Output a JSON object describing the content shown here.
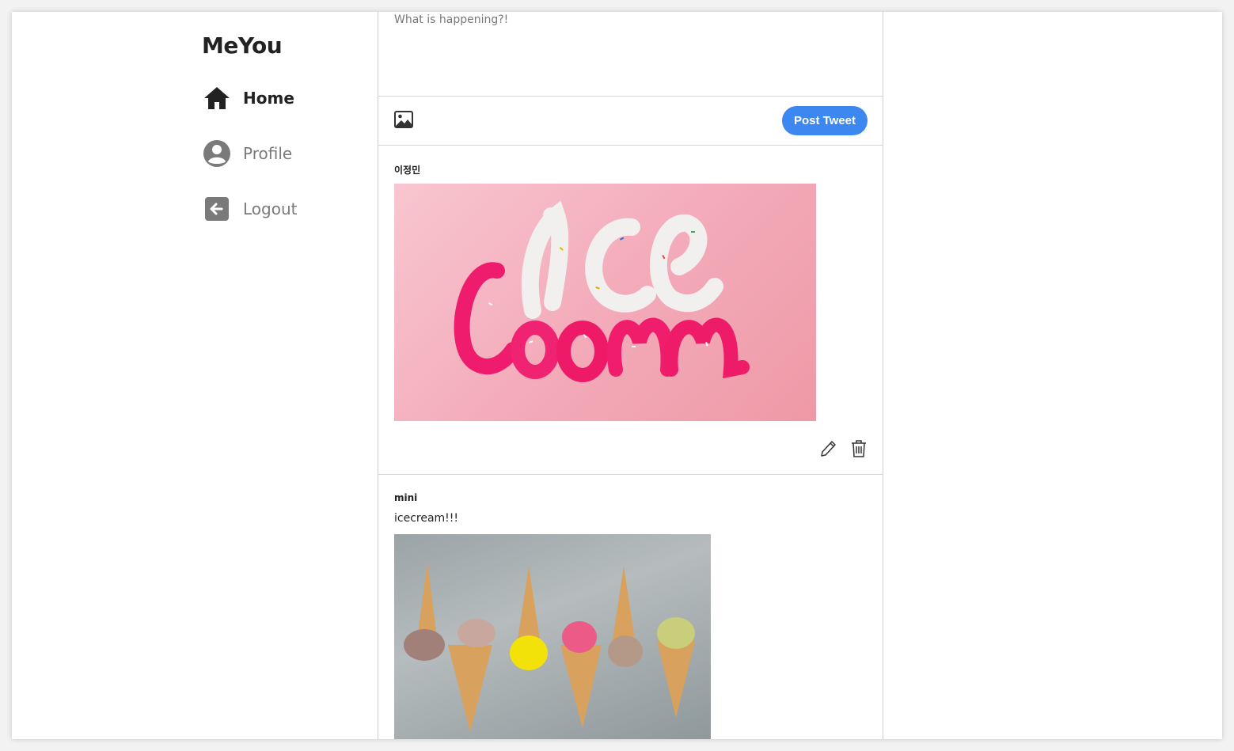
{
  "app": {
    "brand": "MeYou"
  },
  "sidebar": {
    "items": [
      {
        "label": "Home",
        "icon": "home-icon",
        "active": true
      },
      {
        "label": "Profile",
        "icon": "user-circle-icon",
        "active": false
      },
      {
        "label": "Logout",
        "icon": "logout-icon",
        "active": false
      }
    ]
  },
  "compose": {
    "placeholder": "What is happening?!",
    "value": "",
    "image_icon": "image-icon",
    "post_label": "Post Tweet"
  },
  "tweets": [
    {
      "author": "이정민",
      "text": "",
      "image": "ice-cream-lettering-photo",
      "actions": [
        "edit-icon",
        "trash-icon"
      ]
    },
    {
      "author": "mini",
      "text": "icecream!!!",
      "image": "ice-cream-cones-photo"
    }
  ],
  "colors": {
    "accent": "#3d87f0",
    "active_text": "#222222",
    "inactive_text": "#7a7a7a",
    "border": "#cfcfcf"
  }
}
